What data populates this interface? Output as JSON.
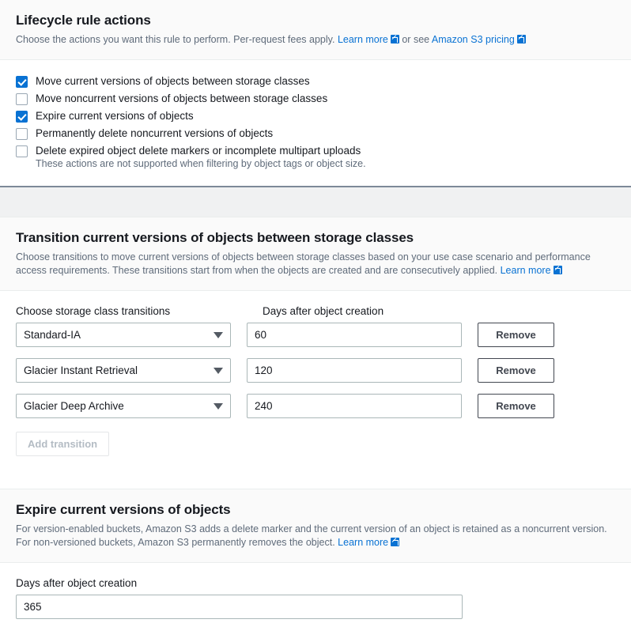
{
  "actions_section": {
    "title": "Lifecycle rule actions",
    "description_pre": "Choose the actions you want this rule to perform. Per-request fees apply.",
    "learn_more": "Learn more",
    "description_mid": "or see",
    "pricing_link": "Amazon S3 pricing",
    "checkboxes": [
      {
        "label": "Move current versions of objects between storage classes",
        "checked": true
      },
      {
        "label": "Move noncurrent versions of objects between storage classes",
        "checked": false
      },
      {
        "label": "Expire current versions of objects",
        "checked": true
      },
      {
        "label": "Permanently delete noncurrent versions of objects",
        "checked": false
      },
      {
        "label": "Delete expired object delete markers or incomplete multipart uploads",
        "checked": false
      }
    ],
    "note": "These actions are not supported when filtering by object tags or object size."
  },
  "transition_section": {
    "title": "Transition current versions of objects between storage classes",
    "description": "Choose transitions to move current versions of objects between storage classes based on your use case scenario and performance access requirements. These transitions start from when the objects are created and are consecutively applied.",
    "learn_more": "Learn more",
    "column_headers": {
      "storage_class": "Choose storage class transitions",
      "days": "Days after object creation"
    },
    "rows": [
      {
        "storage_class": "Standard-IA",
        "days": "60",
        "remove_label": "Remove"
      },
      {
        "storage_class": "Glacier Instant Retrieval",
        "days": "120",
        "remove_label": "Remove"
      },
      {
        "storage_class": "Glacier Deep Archive",
        "days": "240",
        "remove_label": "Remove"
      }
    ],
    "add_transition_label": "Add transition"
  },
  "expire_section": {
    "title": "Expire current versions of objects",
    "description": "For version-enabled buckets, Amazon S3 adds a delete marker and the current version of an object is retained as a noncurrent version. For non-versioned buckets, Amazon S3 permanently removes the object.",
    "learn_more": "Learn more",
    "days_label": "Days after object creation",
    "days_value": "365"
  },
  "colors": {
    "accent": "#0972d3",
    "text": "#16191f",
    "muted": "#5f6b7a",
    "border": "#aab7b8",
    "header_bg": "#fafafa"
  }
}
